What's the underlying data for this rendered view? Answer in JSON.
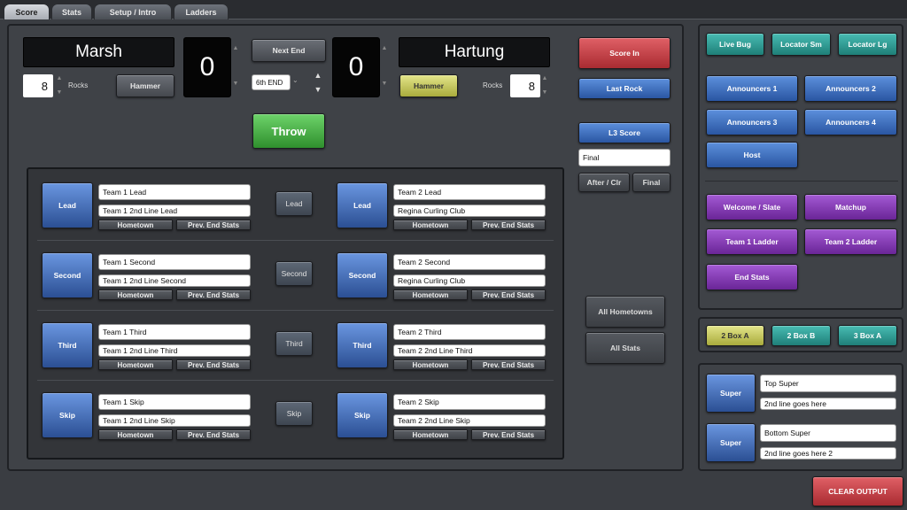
{
  "tabs": [
    {
      "label": "Score",
      "active": true
    },
    {
      "label": "Stats",
      "active": false
    },
    {
      "label": "Setup / Intro",
      "active": false
    },
    {
      "label": "Ladders",
      "active": false
    }
  ],
  "scoreboard": {
    "team1": {
      "name": "Marsh",
      "score": "0",
      "rocks": "8",
      "rocks_label": "Rocks",
      "hammer_label": "Hammer"
    },
    "team2": {
      "name": "Hartung",
      "score": "0",
      "rocks": "8",
      "rocks_label": "Rocks",
      "hammer_label": "Hammer"
    },
    "next_end_label": "Next End",
    "end_select": "6th END",
    "throw_label": "Throw"
  },
  "roster": {
    "rows": [
      {
        "position": "Lead",
        "team1": {
          "button": "Lead",
          "line1": "Team 1 Lead",
          "line2": "Team 1 2nd Line Lead"
        },
        "center": "Lead",
        "team2": {
          "button": "Lead",
          "line1": "Team 2 Lead",
          "line2": "Regina Curling Club"
        }
      },
      {
        "position": "Second",
        "team1": {
          "button": "Second",
          "line1": "Team 1 Second",
          "line2": "Team 1 2nd Line Second"
        },
        "center": "Second",
        "team2": {
          "button": "Second",
          "line1": "Team 2 Second",
          "line2": "Regina Curling Club"
        }
      },
      {
        "position": "Third",
        "team1": {
          "button": "Third",
          "line1": "Team 1 Third",
          "line2": "Team 1 2nd Line Third"
        },
        "center": "Third",
        "team2": {
          "button": "Third",
          "line1": "Team 2 Third",
          "line2": "Team 2 2nd Line Third"
        }
      },
      {
        "position": "Skip",
        "team1": {
          "button": "Skip",
          "line1": "Team 1 Skip",
          "line2": "Team 1 2nd Line Skip"
        },
        "center": "Skip",
        "team2": {
          "button": "Skip",
          "line1": "Team 2 Skip",
          "line2": "Team 2 2nd Line Skip"
        }
      }
    ],
    "hometown_label": "Hometown",
    "prev_end_stats_label": "Prev. End Stats"
  },
  "right_controls": {
    "score_in": "Score In",
    "last_rock": "Last Rock",
    "l3_score": "L3 Score",
    "l3_field": "Final",
    "after_clr": "After / Clr",
    "final": "Final",
    "all_hometowns": "All Hometowns",
    "all_stats": "All Stats"
  },
  "graphics": {
    "live_bug": "Live Bug",
    "locator_sm": "Locator Sm",
    "locator_lg": "Locator Lg",
    "announcers1": "Announcers 1",
    "announcers2": "Announcers 2",
    "announcers3": "Announcers 3",
    "announcers4": "Announcers 4",
    "host": "Host",
    "welcome_slate": "Welcome / Slate",
    "matchup": "Matchup",
    "team1_ladder": "Team 1 Ladder",
    "team2_ladder": "Team 2 Ladder",
    "end_stats": "End Stats"
  },
  "boxes": {
    "box_a": "2 Box A",
    "box_b": "2 Box B",
    "box_3a": "3 Box A"
  },
  "supers": {
    "top": {
      "button": "Super",
      "line1": "Top Super",
      "line2": "2nd line goes here"
    },
    "bottom": {
      "button": "Super",
      "line1": "Bottom Super",
      "line2": "2nd line goes here 2"
    }
  },
  "clear_output": "CLEAR OUTPUT",
  "colors": {
    "red": "#c0393f",
    "blue": "#3b6cc0",
    "green": "#45b043",
    "teal": "#2c9c93",
    "purple": "#8a3ab9",
    "yellow": "#d1d35a"
  }
}
